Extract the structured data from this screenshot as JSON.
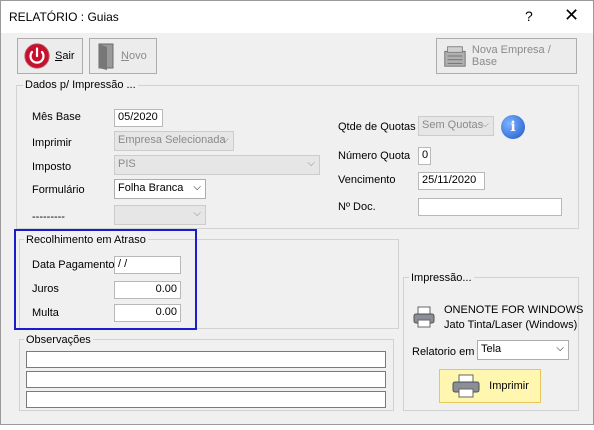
{
  "window": {
    "title": "RELATÓRIO : Guias",
    "help": "?",
    "close": "✕"
  },
  "toolbar": {
    "sair_first": "S",
    "sair_rest": "air",
    "novo_first": "N",
    "novo_rest": "ovo",
    "nova_empresa": "Nova Empresa / Base"
  },
  "dados": {
    "title": "Dados p/ Impressão ...",
    "mes_base_label": "Mês Base",
    "mes_base": "05/2020",
    "imprimir_label": "Imprimir",
    "imprimir": "Empresa Selecionada",
    "imposto_label": "Imposto",
    "imposto": "PIS",
    "formulario_label": "Formulário",
    "formulario": "Folha Branca",
    "extra_label": "---------",
    "extra": "",
    "qtde_label": "Qtde de Quotas",
    "qtde": "Sem Quotas",
    "numero_label": "Número  Quota",
    "numero": "0",
    "vencimento_label": "Vencimento",
    "vencimento": "25/11/2020",
    "nro_doc_label": "Nº Doc.",
    "nro_doc": ""
  },
  "recolhimento": {
    "title": "Recolhimento em Atraso",
    "data_label": "Data Pagamento",
    "data": " / /",
    "juros_label": "Juros",
    "juros": "0.00",
    "multa_label": "Multa",
    "multa": "0.00"
  },
  "observacoes": {
    "title": "Observações"
  },
  "impressao": {
    "title": "Impressão...",
    "printer_name": "ONENOTE FOR WINDOWS",
    "printer_type": "Jato Tinta/Laser (Windows)",
    "relatorio_label": "Relatorio em :",
    "relatorio": "Tela",
    "imprimir_btn": "Imprimir"
  },
  "colors": {
    "highlight": "#1c1ccc",
    "print_button": "#fff6b0"
  }
}
